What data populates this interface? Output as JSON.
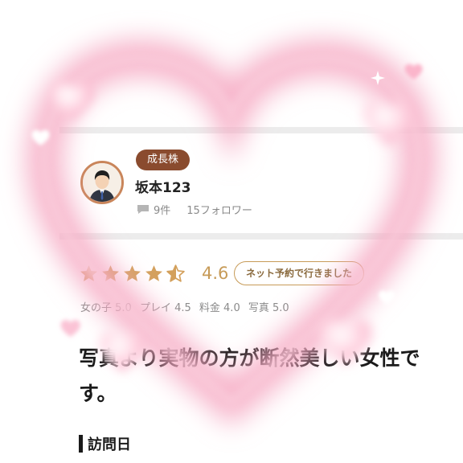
{
  "colors": {
    "accent_brown": "#8a4b2e",
    "star_gold": "#d3a05c",
    "pink": "#f7b6cc"
  },
  "profile": {
    "badge": "成長株",
    "username": "坂本123",
    "post_count": "9件",
    "followers": "15フォロワー"
  },
  "review": {
    "stars": 4.6,
    "rating": "4.6",
    "booking_badge": "ネット予約で行きました",
    "subscores": [
      "女の子 5.0",
      "プレイ 4.5",
      "料金 4.0",
      "写真 5.0"
    ],
    "title_line1": "写真より実物の方が断然美しい女性で",
    "title_line2": "す。",
    "section_heading": "訪問日"
  }
}
